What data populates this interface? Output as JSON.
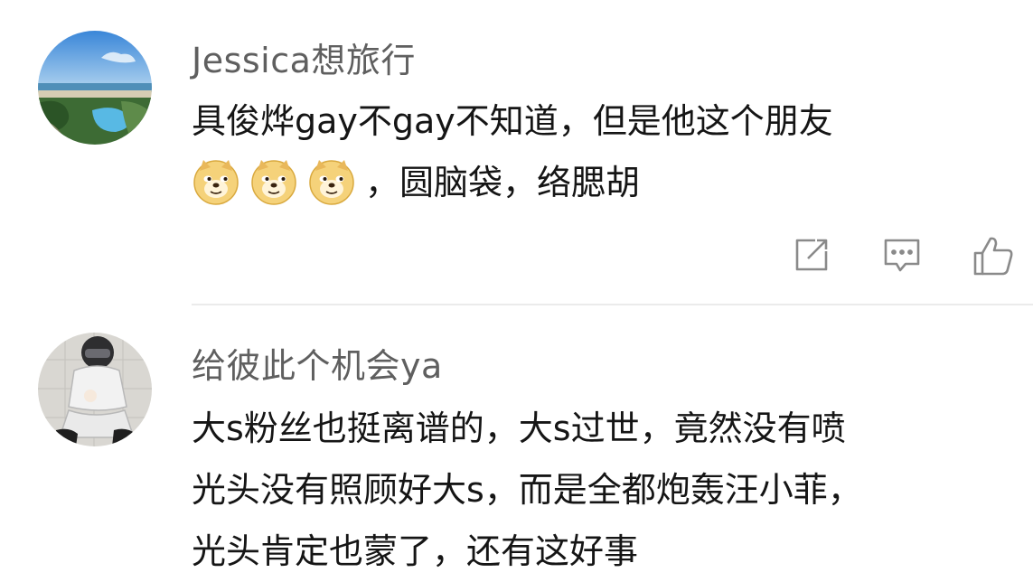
{
  "comments": [
    {
      "username": "Jessica想旅行",
      "text_line1": "具俊烨gay不gay不知道，但是他这个朋友",
      "emoji_name": "doge-emoji",
      "emoji_count": 3,
      "text_line2": "，圆脑袋，络腮胡",
      "actions": [
        "share-icon",
        "comment-icon",
        "like-icon"
      ]
    },
    {
      "username": "给彼此个机会ya",
      "text_lines": [
        "大s粉丝也挺离谱的，大s过世，竟然没有喷",
        "光头没有照顾好大s，而是全都炮轰汪小菲，",
        "光头肯定也蒙了，还有这好事"
      ]
    }
  ]
}
